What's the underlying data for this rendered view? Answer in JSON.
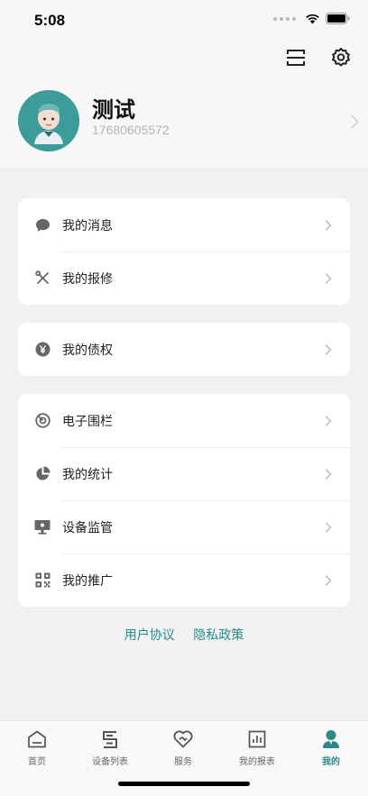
{
  "status": {
    "time": "5:08"
  },
  "profile": {
    "name": "测试",
    "phone": "17680605572"
  },
  "menu_groups": [
    [
      {
        "label": "我的消息",
        "icon": "message-icon"
      },
      {
        "label": "我的报修",
        "icon": "repair-icon"
      }
    ],
    [
      {
        "label": "我的债权",
        "icon": "yen-icon"
      }
    ],
    [
      {
        "label": "电子围栏",
        "icon": "fence-icon"
      },
      {
        "label": "我的统计",
        "icon": "pie-chart-icon"
      },
      {
        "label": "设备监管",
        "icon": "monitor-icon"
      },
      {
        "label": "我的推广",
        "icon": "qr-code-icon"
      }
    ]
  ],
  "links": {
    "user_agreement": "用户协议",
    "privacy_policy": "隐私政策"
  },
  "tabs": [
    {
      "label": "首页",
      "icon": "home-icon"
    },
    {
      "label": "设备列表",
      "icon": "device-list-icon"
    },
    {
      "label": "服务",
      "icon": "service-icon"
    },
    {
      "label": "我的报表",
      "icon": "report-icon"
    },
    {
      "label": "我的",
      "icon": "profile-icon",
      "active": true
    }
  ],
  "colors": {
    "accent": "#2b8a87",
    "avatar_bg": "#3c9c9a"
  }
}
